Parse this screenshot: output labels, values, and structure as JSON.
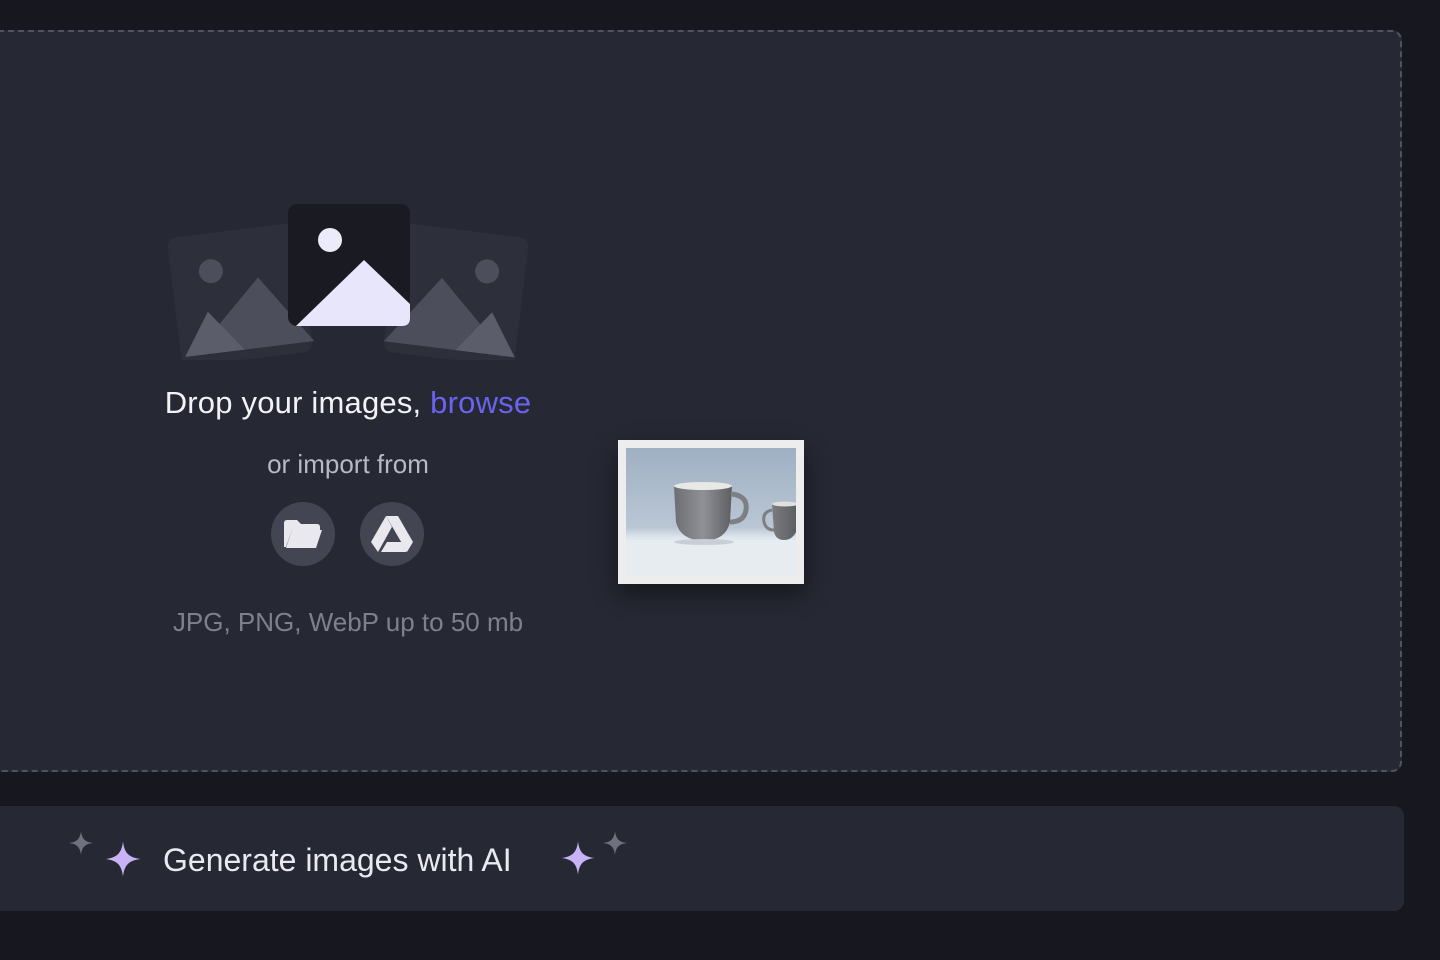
{
  "dropzone": {
    "title_prefix": "Drop your images, ",
    "browse_link": "browse",
    "import_label": "or import from",
    "formats_label": "JPG, PNG, WebP up to 50 mb",
    "import_sources": [
      {
        "name": "Local files",
        "icon": "folder-icon"
      },
      {
        "name": "Google Drive",
        "icon": "google-drive-icon"
      }
    ]
  },
  "drag_preview": {
    "subject": "ceramic cups thumbnail"
  },
  "ai_generate": {
    "label": "Generate images with AI",
    "icon": "sparkle-icon"
  },
  "colors": {
    "background": "#17181f",
    "panel": "#262833",
    "accent_link": "#6a63ee",
    "sparkle": "#c9b3f5"
  }
}
